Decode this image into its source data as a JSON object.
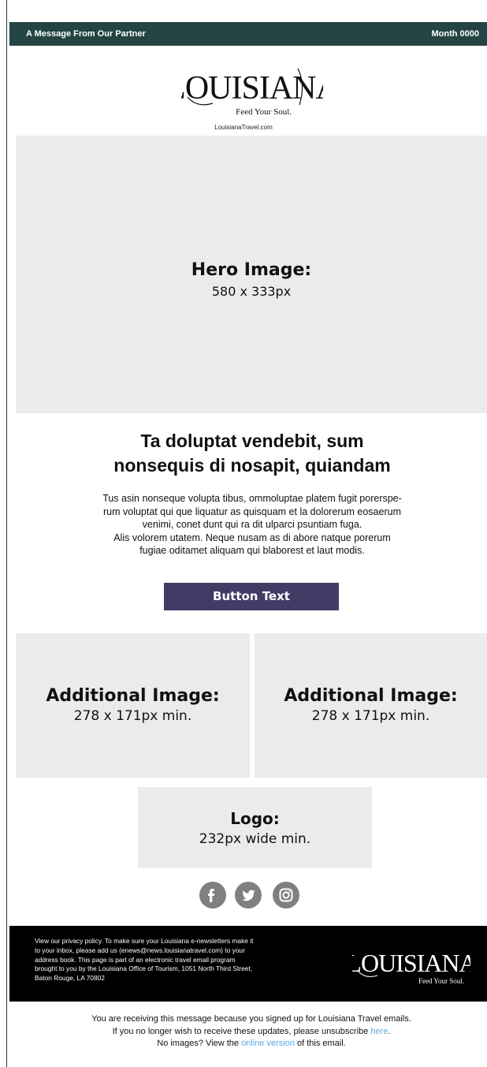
{
  "topbar": {
    "left_text": "A Message From Our Partner",
    "right_text": "Month 0000"
  },
  "brand": {
    "logo_text": "LOUISIANA",
    "tagline": "Feed Your Soul.",
    "url": "LouisianaTravel.com"
  },
  "hero": {
    "title": "Hero Image:",
    "subtitle": "580 x 333px"
  },
  "article": {
    "headline_line1": "Ta doluptat vendebit, sum",
    "headline_line2": "nonsequis di nosapit, quiandam",
    "body_line1": "Tus asin nonseque volupta tibus, ommoluptae platem fugit porerspe-",
    "body_line2": "rum voluptat qui que liquatur as quisquam et la dolorerum eosaerum",
    "body_line3": "venimi, conet dunt qui ra dit ulparci psuntiam fuga.",
    "body_line4": "Alis volorem utatem. Neque nusam as di abore natque porerum",
    "body_line5": "fugiae oditamet aliquam qui blaborest et laut modis."
  },
  "cta": {
    "label": "Button Text"
  },
  "additional_images": [
    {
      "title": "Additional Image:",
      "subtitle": "278 x 171px min."
    },
    {
      "title": "Additional Image:",
      "subtitle": "278 x 171px min."
    }
  ],
  "logo_placeholder": {
    "title": "Logo:",
    "subtitle": "232px wide min."
  },
  "social": [
    "facebook-icon",
    "twitter-icon",
    "instagram-icon"
  ],
  "footer": {
    "legal_line1": "View our privacy policy. To make sure your Louisiana e-newsletters make it",
    "legal_line2": "to your inbox, please add us (enews@news.louisianatravel.com) to your",
    "legal_line3": "address book. This page is part of an electronic travel email program",
    "legal_line4": "brought to you by the Louisiana Office of Tourism, 1051 North Third Street,",
    "legal_line5": "Baton Rouge, LA 70802",
    "logo_text": "LOUISIANA",
    "tagline": "Feed Your Soul."
  },
  "notes": {
    "line1": "You are receiving this message because you signed up for Louisiana Travel emails.",
    "line2_prefix": "If you no longer wish to receive these updates, please unsubscribe ",
    "line2_link": "here",
    "line2_suffix": ".",
    "line3_prefix": "No images? View the ",
    "line3_link": "online version",
    "line3_suffix": " of this email."
  },
  "colors": {
    "topbar_bg": "#244443",
    "button_bg": "#403c66",
    "placeholder_bg": "#ebebeb",
    "link": "#5aa9e6",
    "social_gray": "#808080"
  }
}
